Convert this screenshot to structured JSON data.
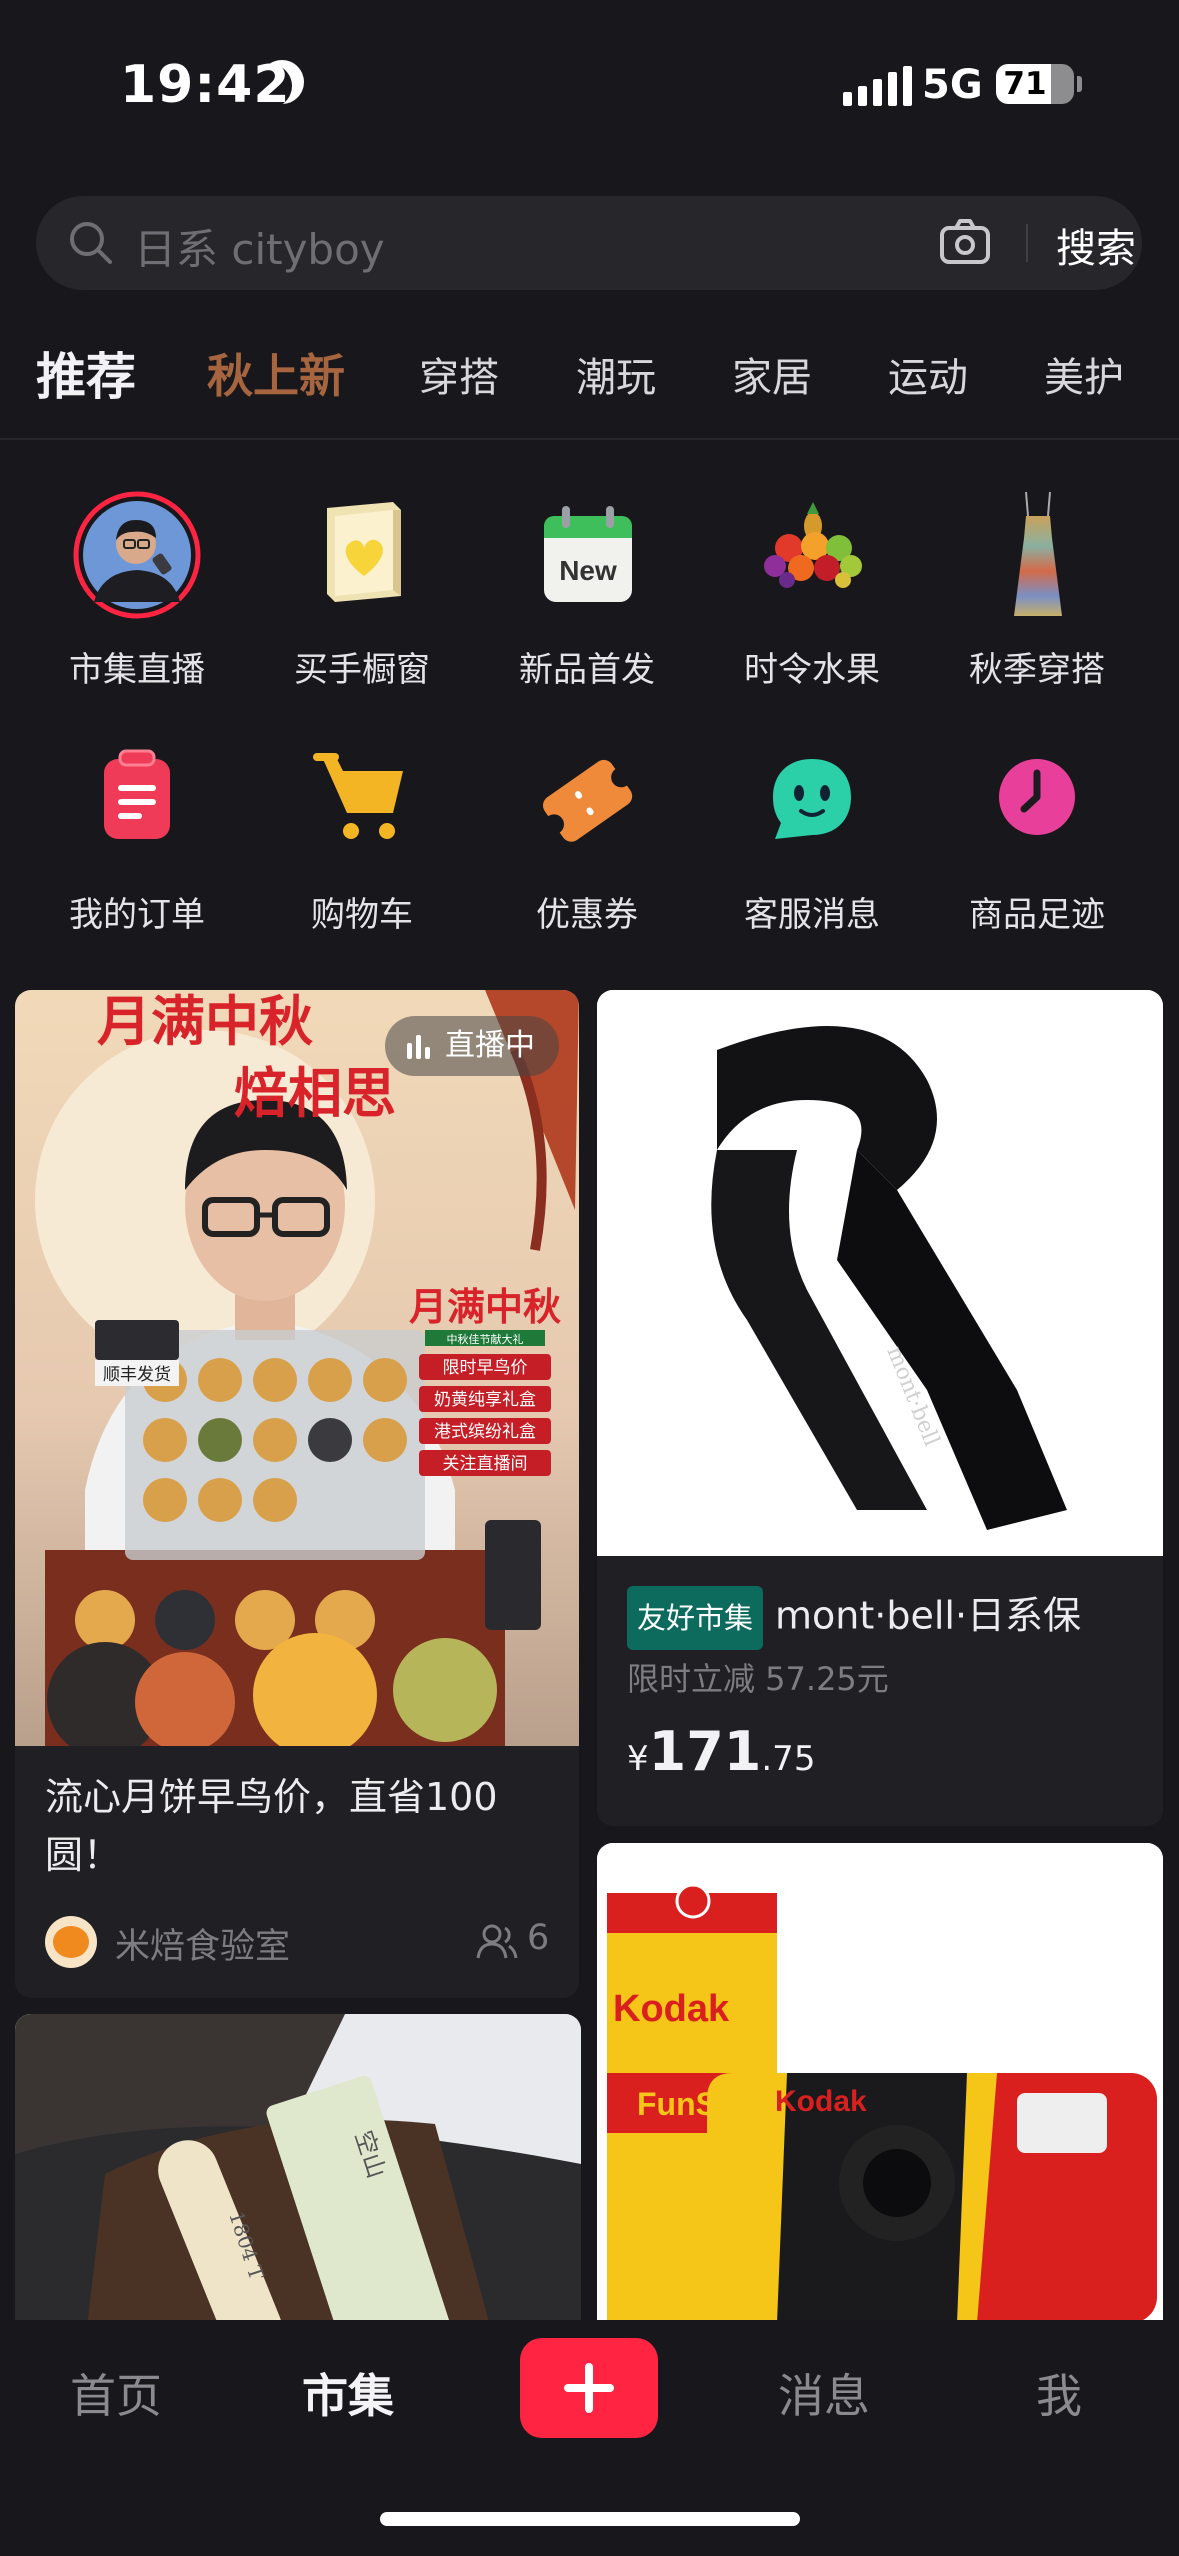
{
  "status_bar": {
    "time": "19:42",
    "network": "5G",
    "battery": "71",
    "battery_level": 0.71
  },
  "search": {
    "placeholder": "日系 cityboy",
    "button": "搜索"
  },
  "tabs": [
    {
      "label": "推荐"
    },
    {
      "label": "秋上新"
    },
    {
      "label": "穿搭"
    },
    {
      "label": "潮玩"
    },
    {
      "label": "家居"
    },
    {
      "label": "运动"
    },
    {
      "label": "美护"
    }
  ],
  "quick_row1": [
    {
      "label": "市集直播",
      "icon": "live-avatar-icon"
    },
    {
      "label": "买手橱窗",
      "icon": "showcase-box-icon"
    },
    {
      "label": "新品首发",
      "icon": "new-calendar-icon",
      "badge": "New"
    },
    {
      "label": "时令水果",
      "icon": "fruit-basket-icon"
    },
    {
      "label": "秋季穿搭",
      "icon": "dress-icon"
    }
  ],
  "quick_row2": [
    {
      "label": "我的订单",
      "icon": "clipboard-icon",
      "color": "#ef3b58"
    },
    {
      "label": "购物车",
      "icon": "cart-icon",
      "color": "#f3b524"
    },
    {
      "label": "优惠券",
      "icon": "coupon-icon",
      "color": "#ef8a3a"
    },
    {
      "label": "客服消息",
      "icon": "chat-bot-icon",
      "color": "#2bcfa8"
    },
    {
      "label": "商品足迹",
      "icon": "clock-icon",
      "color": "#e8409a"
    }
  ],
  "feed": {
    "live_card": {
      "badge": "直播中",
      "title": "流心月饼早鸟价，直省100圆！",
      "author": "米焙食验室",
      "viewers": "6",
      "image_text": {
        "headline1": "月满中秋",
        "headline2": "焙相思",
        "side_title": "月满中秋",
        "side_sub": "中秋佳节献大礼",
        "side_items": [
          "限时早鸟价",
          "奶黄纯享礼盒",
          "港式缤纷礼盒",
          "关注直播间"
        ],
        "sf_tag": "顺丰发货"
      }
    },
    "product_card": {
      "tag": "友好市集",
      "title": "mont·bell·日系保",
      "discount": "限时立减 57.25元",
      "price_symbol": "¥",
      "price_int": "171",
      "price_dec": ".75",
      "image_logo": "mont·bell"
    },
    "kodak_card": {
      "brand": "Kodak",
      "sub": "FunS"
    },
    "incense_card": {
      "text1": "空山",
      "text2": "1804 T"
    }
  },
  "bottom_nav": {
    "home": "首页",
    "market": "市集",
    "messages": "消息",
    "me": "我"
  },
  "colors": {
    "accent": "#ff2442",
    "highlight_tab": "#a6643f",
    "tag_green": "#0c6b5c"
  }
}
